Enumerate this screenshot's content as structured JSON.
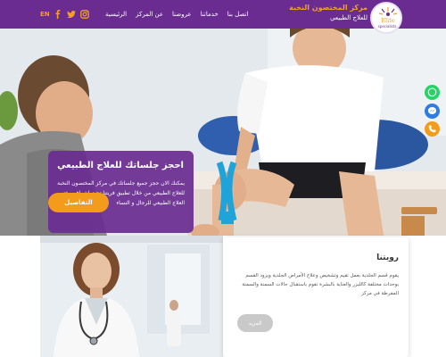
{
  "header": {
    "brand_title": "مركز المختصون النخبة",
    "brand_subtitle": "للعلاج الطبيعي",
    "logo_text": "Elite",
    "logo_subtext": "specialists",
    "language": "EN",
    "nav": [
      {
        "label": "الرئيسية"
      },
      {
        "label": "عن المركز"
      },
      {
        "label": "عروضنا"
      },
      {
        "label": "خدماتنا"
      },
      {
        "label": "اتصل بنا"
      }
    ],
    "social_icons": [
      "facebook-icon",
      "twitter-icon",
      "instagram-icon"
    ]
  },
  "hero": {
    "title": "احجز جلساتك للعلاج الطبيعي",
    "description": "يمكنك الان حجز جميع جلساتك في مركز المختصون النخبة للعلاج الطبيعي من خلال تطبيق فريتنا تحت اشراف مختص العلاج الطبيعي للرجال و النساء",
    "details_button": "التفاصيل"
  },
  "floating_buttons": [
    "whatsapp-icon",
    "messenger-icon",
    "phone-icon"
  ],
  "vision": {
    "title": "رويتنا",
    "text": "يقوم قسم الجلدية بعمل تقيم وتشخيص وعلاج الأمراض الجلدية ويزود القسم بوحدات مختلفة كالليزر والعناية بالبشرة تقوم باستقبال حالات السمنة والسمنة المفرطة في مركز",
    "more_button": "المزيد"
  },
  "colors": {
    "brand_purple": "#6a2c91",
    "accent_orange": "#f39b1a",
    "whatsapp_green": "#25d366",
    "messenger_blue": "#2f7de1"
  }
}
